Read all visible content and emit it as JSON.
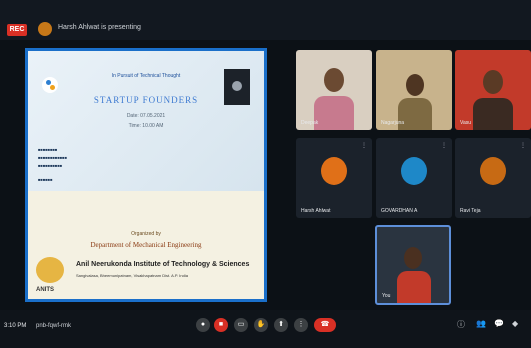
{
  "topbar": {
    "rec_label": "REC",
    "presenting_text": "Harsh Ahlwat is presenting"
  },
  "slide": {
    "small_title": "In Pursuit of Technical Thought",
    "heading": "STARTUP FOUNDERS",
    "line1": "Date: 07.05.2021",
    "line2": "Time: 10.00 AM",
    "organized_by": "Organized by",
    "department": "Department of Mechanical Engineering",
    "institute": "Anil Neerukonda Institute of Technology & Sciences",
    "address": "Sangivalasa, Bheemunipatnam, Visakhapatnam Dist. A.P. India",
    "logo_text": "ANITS"
  },
  "participants": [
    {
      "name": "Deepak",
      "kind": "video"
    },
    {
      "name": "Nagarjuna",
      "kind": "video"
    },
    {
      "name": "Vasu",
      "kind": "video"
    },
    {
      "name": "Harsh Ahlwat",
      "kind": "avatar",
      "color": "#e07018"
    },
    {
      "name": "GOVARDHAN A",
      "kind": "avatar",
      "color": "#1e88c8"
    },
    {
      "name": "Ravi Teja",
      "kind": "avatar",
      "color": "#c76a14"
    },
    {
      "name": "You",
      "kind": "video"
    }
  ],
  "bottombar": {
    "time": "3:10 PM",
    "meeting_code": "pnb-fqwf-rmk"
  },
  "colors": {
    "accent": "#1a6fc9",
    "end_call": "#d93025"
  }
}
